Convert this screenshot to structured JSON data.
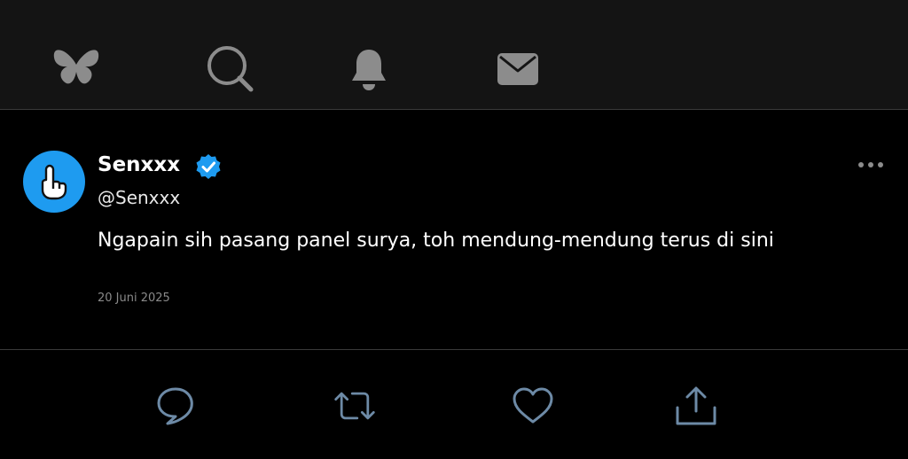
{
  "nav": {
    "icons": [
      "butterfly-icon",
      "search-icon",
      "bell-icon",
      "mail-icon"
    ]
  },
  "post": {
    "display_name": "Senxxx",
    "handle": "@Senxxx",
    "text": "Ngapain sih pasang panel surya, toh mendung-mendung terus di sini",
    "date": "20 Juni 2025",
    "verified": true
  },
  "actions": {
    "icons": [
      "reply-icon",
      "repost-icon",
      "like-icon",
      "share-icon"
    ]
  },
  "colors": {
    "background": "#000000",
    "nav_background": "#141414",
    "icon": "#8c8c8c",
    "action_icon": "#6d8aa6",
    "accent": "#1e9bf0",
    "text": "#ffffff",
    "muted": "#8a8a8a"
  }
}
